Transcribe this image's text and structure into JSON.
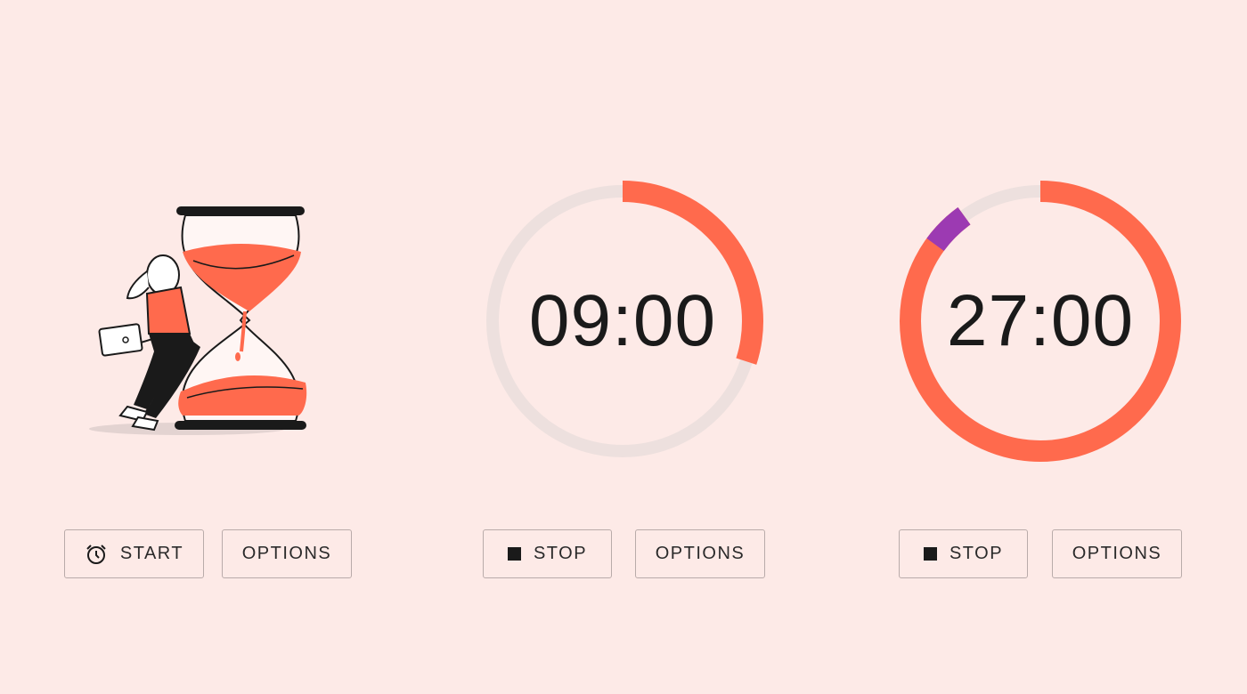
{
  "colors": {
    "background": "#FDEAE7",
    "accent": "#FF6A4D",
    "secondary_accent": "#9C3AB2",
    "track": "#EDE0DE",
    "text": "#1A1A1A"
  },
  "panel_1": {
    "illustration": "person-with-laptop-leaning-on-hourglass",
    "start_icon": "alarm-clock-icon",
    "start_label": "START",
    "options_label": "OPTIONS"
  },
  "panel_2": {
    "time": "09:00",
    "progress_fraction": 0.3,
    "stop_icon": "stop-icon",
    "stop_label": "STOP",
    "options_label": "OPTIONS"
  },
  "panel_3": {
    "time": "27:00",
    "progress_fraction": 0.9,
    "secondary_segment_fraction": 0.05,
    "stop_icon": "stop-icon",
    "stop_label": "STOP",
    "options_label": "OPTIONS"
  }
}
